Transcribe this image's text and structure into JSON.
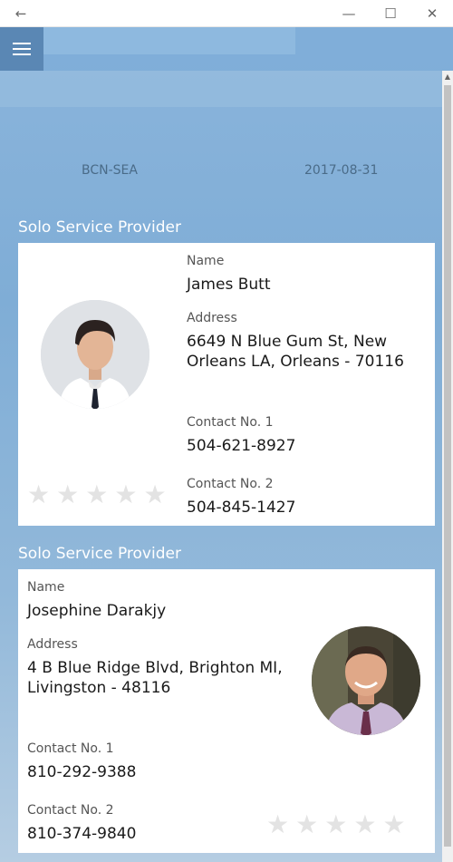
{
  "window": {
    "back_glyph": "←",
    "minimize_glyph": "—",
    "maximize_glyph": "☐",
    "close_glyph": "✕"
  },
  "trip": {
    "route": "BCN-SEA",
    "date": "2017-08-31"
  },
  "providers": [
    {
      "section_title": "Solo Service Provider",
      "name_label": "Name",
      "name": "James Butt",
      "address_label": "Address",
      "address_line1": "6649 N Blue Gum St, New",
      "address_line2": "Orleans LA, Orleans - 70116",
      "contact1_label": "Contact No. 1",
      "contact1": "504-621-8927",
      "contact2_label": "Contact No. 2",
      "contact2": "504-845-1427",
      "rating": 0,
      "rating_max": 5
    },
    {
      "section_title": "Solo Service Provider",
      "name_label": "Name",
      "name": "Josephine Darakjy",
      "address_label": "Address",
      "address_line1": "4 B Blue Ridge Blvd, Brighton MI,",
      "address_line2": "Livingston - 48116",
      "contact1_label": "Contact No. 1",
      "contact1": "810-292-9388",
      "contact2_label": "Contact No. 2",
      "contact2": "810-374-9840",
      "rating": 0,
      "rating_max": 5
    }
  ],
  "icons": {
    "back": "arrow-left-icon",
    "menu": "hamburger-menu-icon",
    "star": "star-icon",
    "avatar": "person-avatar"
  }
}
